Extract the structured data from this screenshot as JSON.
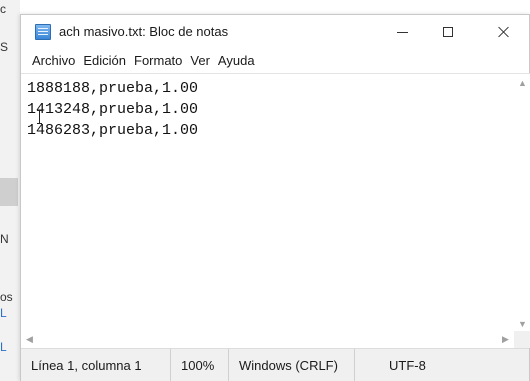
{
  "background": {
    "fragments": [
      "c",
      "S",
      "N",
      "os",
      "L",
      "L"
    ]
  },
  "window": {
    "title": "ach masivo.txt: Bloc de notas",
    "icon": "notepad-icon",
    "controls": {
      "minimize": "—",
      "maximize": "□",
      "close": "✕"
    }
  },
  "menu": {
    "items": [
      "Archivo",
      "Edición",
      "Formato",
      "Ver",
      "Ayuda"
    ]
  },
  "editor": {
    "lines": [
      "1888188,prueba,1.00",
      "1413248,prueba,1.00",
      "1486283,prueba,1.00"
    ]
  },
  "status": {
    "position": "Línea 1, columna 1",
    "zoom": "100%",
    "line_ending": "Windows (CRLF)",
    "encoding": "UTF-8"
  },
  "colors": {
    "accent": "#3a86d6",
    "statusbar": "#f0f0f0"
  }
}
